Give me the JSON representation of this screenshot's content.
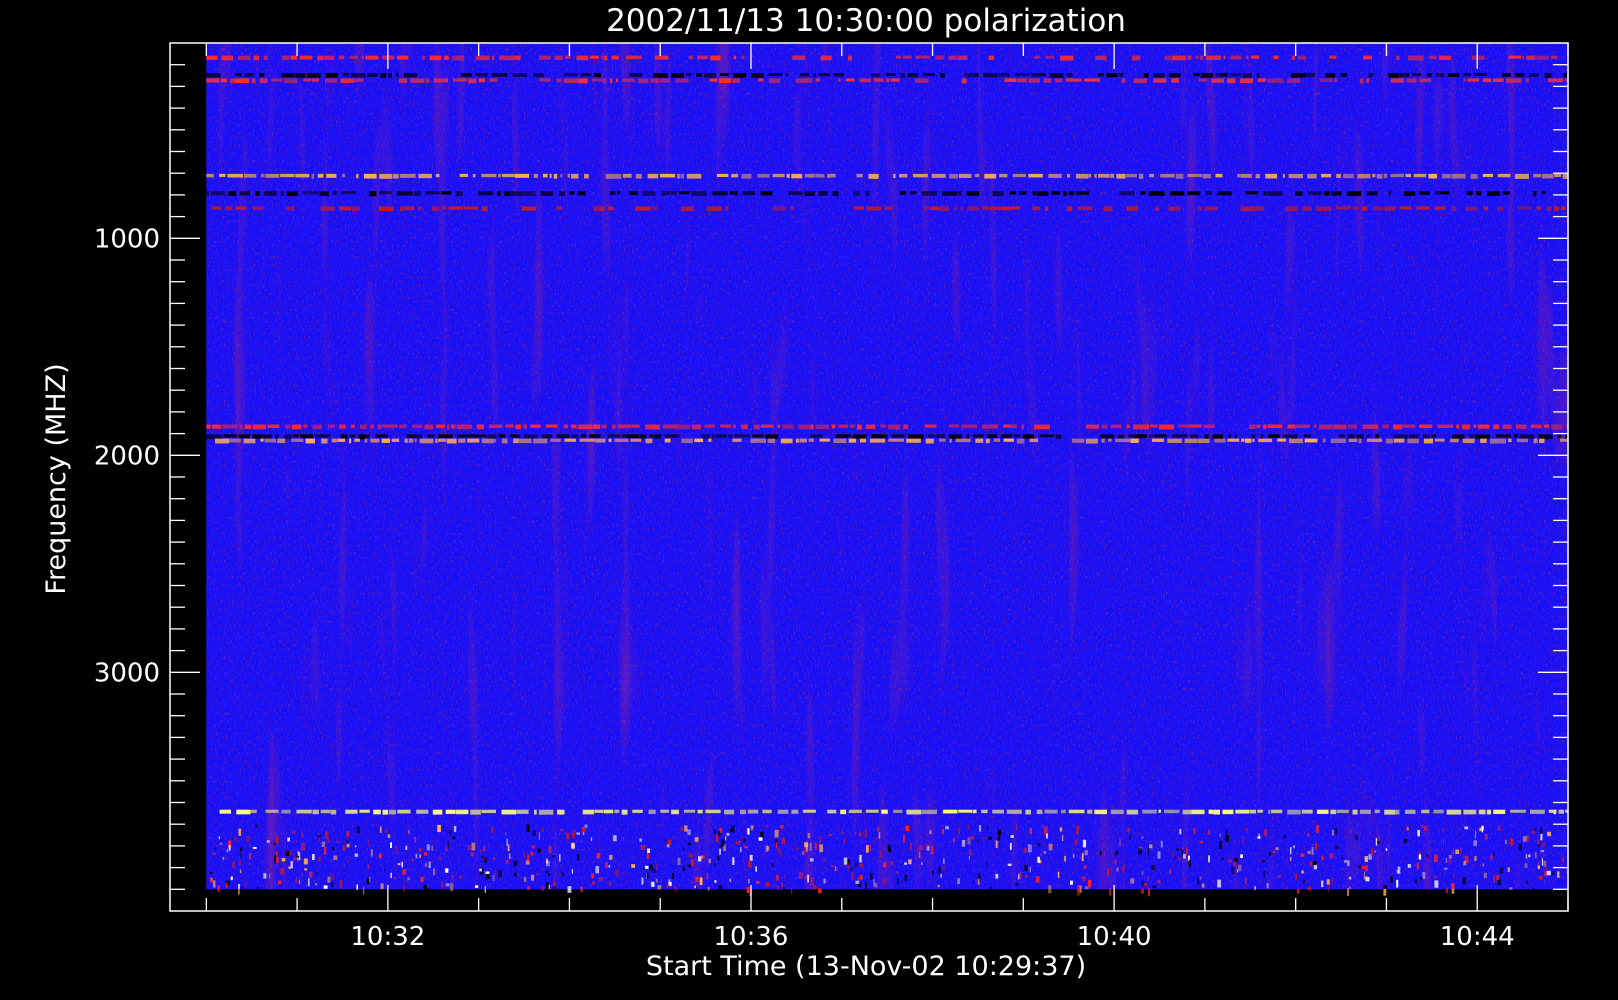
{
  "chart_data": {
    "type": "heatmap",
    "title": "2002/11/13 10:30:00 polarization",
    "xlabel": "Start Time (13-Nov-02 10:29:37)",
    "ylabel": "Frequency (MHZ)",
    "x_tick_labels": [
      "10:32",
      "10:36",
      "10:40",
      "10:44"
    ],
    "x_ticks_minutes": [
      32,
      36,
      40,
      44
    ],
    "xlim_minutes": [
      29.6,
      45.0
    ],
    "y_tick_labels": [
      "1000",
      "2000",
      "3000"
    ],
    "y_ticks": [
      1000,
      2000,
      3000
    ],
    "ylim": [
      100,
      4100
    ],
    "y_inverted": true,
    "data_extent": {
      "x_minutes": [
        30.0,
        45.0
      ],
      "y": [
        100,
        4000
      ]
    },
    "background_color": "#1a10f5",
    "colorscale": [
      "#000000",
      "#1a10f5",
      "#cc1a1a",
      "#ff7a00",
      "#ffff80"
    ],
    "features": [
      {
        "kind": "band",
        "y": 165,
        "color": "#ff2a2a",
        "intensity": 0.5
      },
      {
        "kind": "band",
        "y": 245,
        "color": "#000000",
        "intensity": 0.7
      },
      {
        "kind": "band",
        "y": 270,
        "color": "#ff3030",
        "intensity": 0.6
      },
      {
        "kind": "band",
        "y": 710,
        "color": "#ffb050",
        "intensity": 0.9
      },
      {
        "kind": "band",
        "y": 790,
        "color": "#000000",
        "intensity": 0.8
      },
      {
        "kind": "band",
        "y": 860,
        "color": "#cc1a1a",
        "intensity": 0.4
      },
      {
        "kind": "band",
        "y": 1865,
        "color": "#ff2a2a",
        "intensity": 1.0
      },
      {
        "kind": "band",
        "y": 1910,
        "color": "#000000",
        "intensity": 0.9
      },
      {
        "kind": "band",
        "y": 1930,
        "color": "#ffb050",
        "intensity": 0.9
      },
      {
        "kind": "band",
        "y": 3640,
        "color": "#ffff80",
        "intensity": 1.0
      }
    ]
  }
}
